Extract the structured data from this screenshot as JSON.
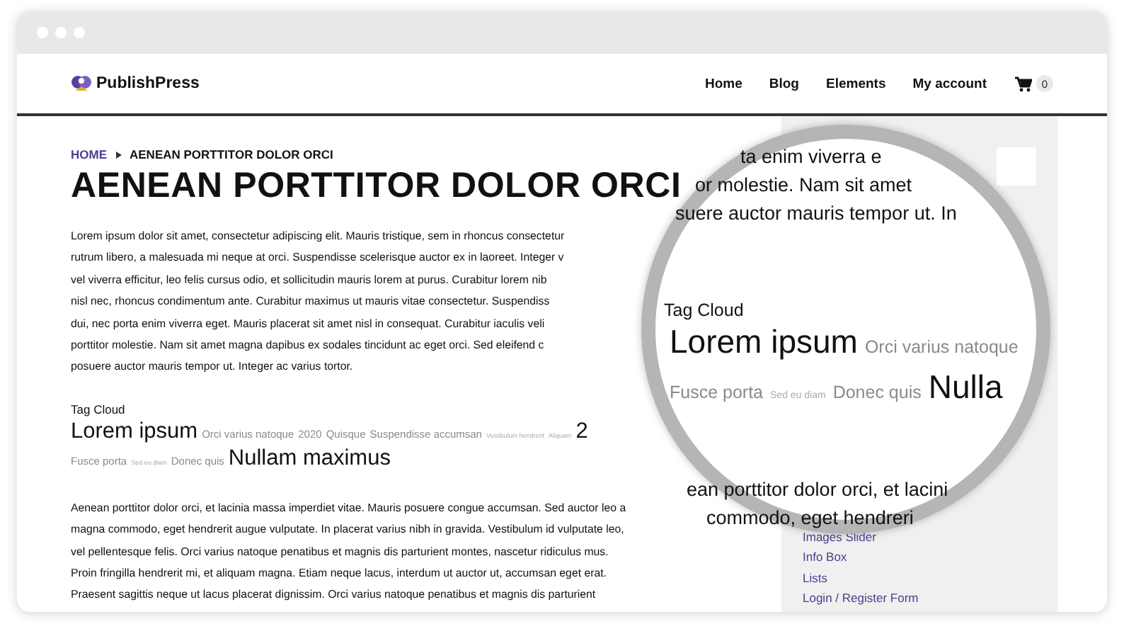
{
  "header": {
    "logo": "PublishPress",
    "nav": [
      {
        "label": "Home"
      },
      {
        "label": "Blog"
      },
      {
        "label": "Elements"
      },
      {
        "label": "My account"
      }
    ],
    "cart_count": "0"
  },
  "breadcrumb": {
    "home": "HOME",
    "current": "AENEAN PORTTITOR DOLOR ORCI"
  },
  "title": "AENEAN PORTTITOR DOLOR ORCI",
  "paragraph_1": [
    "Lorem ipsum dolor sit amet, consectetur adipiscing elit. Mauris tristique, sem in rhoncus consectetur",
    "rutrum libero, a malesuada mi neque at orci. Suspendisse scelerisque auctor ex in laoreet. Integer v",
    "vel viverra efficitur, leo felis cursus odio, et sollicitudin mauris lorem at purus. Curabitur lorem nib",
    "nisl nec, rhoncus condimentum ante. Curabitur maximus ut mauris vitae consectetur. Suspendiss",
    "dui, nec porta enim viverra eget. Mauris placerat sit amet nisl in consequat. Curabitur iaculis veli",
    "porttitor molestie. Nam sit amet magna dapibus ex sodales tincidunt ac eget orci. Sed eleifend c",
    "posuere auctor mauris tempor ut. Integer ac varius tortor."
  ],
  "tag_cloud": {
    "title": "Tag Cloud",
    "tags": [
      {
        "text": "Lorem ipsum",
        "kind": "large"
      },
      {
        "text": "Orci varius natoque",
        "kind": "small"
      },
      {
        "text": "2020",
        "kind": "small"
      },
      {
        "text": "Quisque",
        "kind": "small"
      },
      {
        "text": "Suspendisse accumsan",
        "kind": "small"
      },
      {
        "text": "Vestibulum hendrerit",
        "kind": "tiny"
      },
      {
        "text": "Aliquam",
        "kind": "tiny"
      },
      {
        "text": "2",
        "kind": "large"
      },
      {
        "text": "Fusce porta",
        "kind": "small"
      },
      {
        "text": "Sed eu diam",
        "kind": "tiny"
      },
      {
        "text": "Donec quis",
        "kind": "small"
      },
      {
        "text": "Nullam maximus",
        "kind": "large"
      }
    ]
  },
  "paragraph_2": [
    "Aenean porttitor dolor orci, et lacinia massa imperdiet vitae. Mauris posuere congue accumsan. Sed auctor leo a",
    "magna commodo, eget hendrerit augue vulputate. In placerat varius nibh in gravida. Vestibulum id vulputate leo,",
    "vel pellentesque felis. Orci varius natoque penatibus et magnis dis parturient montes, nascetur ridiculus mus.",
    "Proin fringilla hendrerit mi, et aliquam magna. Etiam neque lacus, interdum ut auctor ut, accumsan eget erat.",
    "Praesent sagittis neque ut lacus placerat dignissim. Orci varius natoque penatibus et magnis dis parturient"
  ],
  "sidebar": {
    "links": [
      {
        "label": "Images Slider"
      },
      {
        "label": "Info Box"
      },
      {
        "label": "Lists"
      },
      {
        "label": "Login / Register Form"
      }
    ]
  },
  "magnifier": {
    "lines_top": [
      "ta enim viverra e",
      "or molestie. Nam sit amet",
      "suere auctor mauris tempor ut. In"
    ],
    "tag_cloud": {
      "title": "Tag Cloud",
      "tags": [
        {
          "text": "Lorem ipsum",
          "kind": "large"
        },
        {
          "text": "Orci varius natoque",
          "kind": "small"
        },
        {
          "text": "Fusce porta",
          "kind": "small"
        },
        {
          "text": "Sed eu diam",
          "kind": "tiny"
        },
        {
          "text": "Donec quis",
          "kind": "small"
        },
        {
          "text": "Nulla",
          "kind": "large"
        }
      ]
    },
    "lines_bottom": [
      "ean porttitor dolor orci, et lacini",
      "commodo, eget hendreri"
    ]
  }
}
